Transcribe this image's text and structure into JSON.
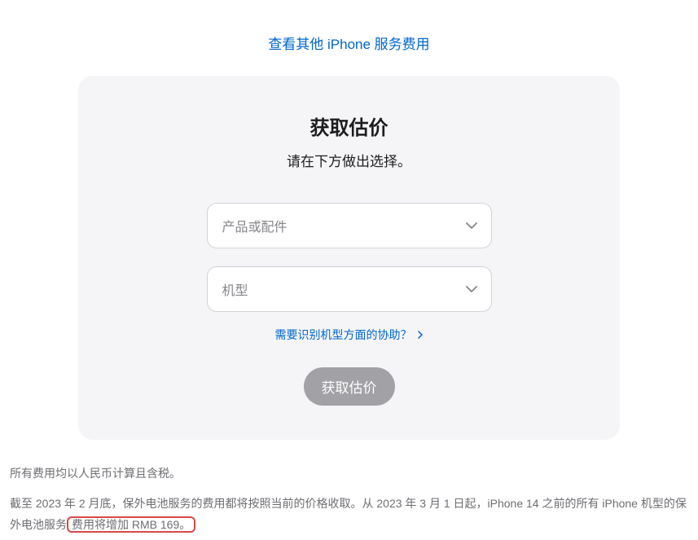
{
  "topLink": {
    "label": "查看其他 iPhone 服务费用"
  },
  "card": {
    "title": "获取估价",
    "subtitle": "请在下方做出选择。",
    "select1": {
      "placeholder": "产品或配件"
    },
    "select2": {
      "placeholder": "机型"
    },
    "helpLink": {
      "label": "需要识别机型方面的协助？"
    },
    "button": {
      "label": "获取估价"
    }
  },
  "footnotes": {
    "line1": "所有费用均以人民币计算且含税。",
    "line2_part1": "截至 2023 年 2 月底，保外电池服务的费用都将按照当前的价格收取。从 2023 年 3 月 1 日起，iPhone 14 之前的所有 iPhone 机型的保外电池服务",
    "line2_highlight": "费用将增加 RMB 169。"
  }
}
